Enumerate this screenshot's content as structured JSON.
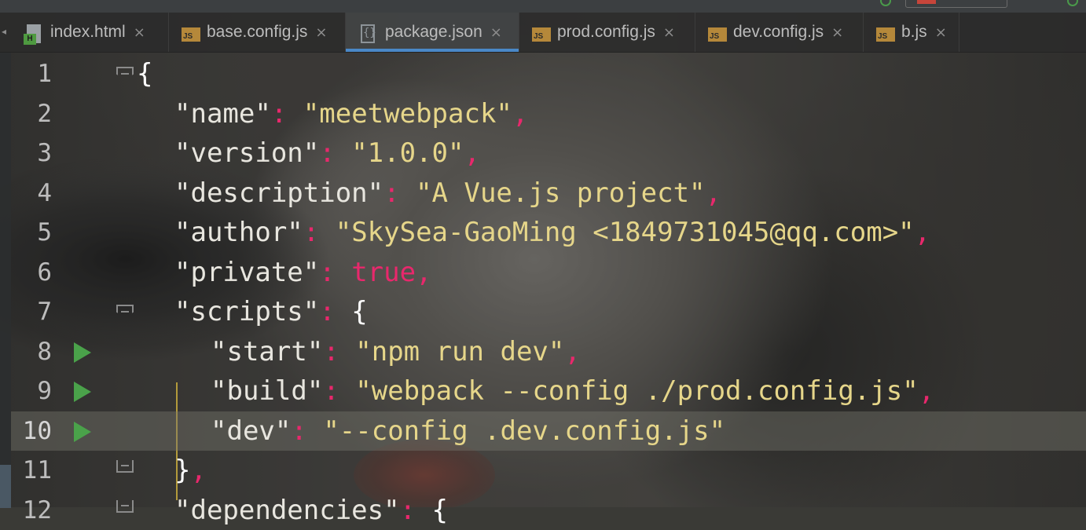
{
  "tabs": [
    {
      "label": "index.html",
      "icon": "html-file-icon",
      "active": false
    },
    {
      "label": "base.config.js",
      "icon": "js-file-icon",
      "active": false
    },
    {
      "label": "package.json",
      "icon": "json-file-icon",
      "active": true
    },
    {
      "label": "prod.config.js",
      "icon": "js-file-icon",
      "active": false
    },
    {
      "label": "dev.config.js",
      "icon": "js-file-icon",
      "active": false
    },
    {
      "label": "b.js",
      "icon": "js-file-icon",
      "active": false
    }
  ],
  "close_glyph": "×",
  "icon_badges": {
    "js": "JS",
    "html": "H",
    "json": "{}"
  },
  "editor": {
    "current_line": 10,
    "lines": [
      {
        "n": "1",
        "parts": [
          {
            "t": "{",
            "c": "br"
          }
        ]
      },
      {
        "n": "2",
        "parts": [
          {
            "t": "\"name\"",
            "c": "k"
          },
          {
            "t": ": ",
            "c": "p"
          },
          {
            "t": "\"meetwebpack\"",
            "c": "s"
          },
          {
            "t": ",",
            "c": "p"
          }
        ]
      },
      {
        "n": "3",
        "parts": [
          {
            "t": "\"version\"",
            "c": "k"
          },
          {
            "t": ": ",
            "c": "p"
          },
          {
            "t": "\"1.0.0\"",
            "c": "s"
          },
          {
            "t": ",",
            "c": "p"
          }
        ]
      },
      {
        "n": "4",
        "parts": [
          {
            "t": "\"description\"",
            "c": "k"
          },
          {
            "t": ": ",
            "c": "p"
          },
          {
            "t": "\"A Vue.js project\"",
            "c": "s"
          },
          {
            "t": ",",
            "c": "p"
          }
        ]
      },
      {
        "n": "5",
        "parts": [
          {
            "t": "\"author\"",
            "c": "k"
          },
          {
            "t": ": ",
            "c": "p"
          },
          {
            "t": "\"SkySea-GaoMing <1849731045@qq.com>\"",
            "c": "s"
          },
          {
            "t": ",",
            "c": "p"
          }
        ]
      },
      {
        "n": "6",
        "parts": [
          {
            "t": "\"private\"",
            "c": "k"
          },
          {
            "t": ": ",
            "c": "p"
          },
          {
            "t": "true",
            "c": "b"
          },
          {
            "t": ",",
            "c": "p"
          }
        ]
      },
      {
        "n": "7",
        "parts": [
          {
            "t": "\"scripts\"",
            "c": "k"
          },
          {
            "t": ": ",
            "c": "p"
          },
          {
            "t": "{",
            "c": "br"
          }
        ]
      },
      {
        "n": "8",
        "parts": [
          {
            "t": "\"start\"",
            "c": "k"
          },
          {
            "t": ": ",
            "c": "p"
          },
          {
            "t": "\"npm run dev\"",
            "c": "s"
          },
          {
            "t": ",",
            "c": "p"
          }
        ]
      },
      {
        "n": "9",
        "parts": [
          {
            "t": "\"build\"",
            "c": "k"
          },
          {
            "t": ": ",
            "c": "p"
          },
          {
            "t": "\"webpack --config ./prod.config.js\"",
            "c": "s"
          },
          {
            "t": ",",
            "c": "p"
          }
        ]
      },
      {
        "n": "10",
        "parts": [
          {
            "t": "\"dev\"",
            "c": "k"
          },
          {
            "t": ": ",
            "c": "p"
          },
          {
            "t": "\"--config .dev.config.js\"",
            "c": "s"
          }
        ]
      },
      {
        "n": "11",
        "parts": [
          {
            "t": "}",
            "c": "br"
          },
          {
            "t": ",",
            "c": "p"
          }
        ]
      },
      {
        "n": "12",
        "parts": [
          {
            "t": "\"dependencies\"",
            "c": "k"
          },
          {
            "t": ": ",
            "c": "p"
          },
          {
            "t": "{",
            "c": "br"
          }
        ]
      }
    ]
  },
  "colors": {
    "string": "#e6d68a",
    "punct": "#e8286c",
    "key": "#e8e6df",
    "run": "#4aa24a",
    "tab_underline": "#4a88c7"
  }
}
